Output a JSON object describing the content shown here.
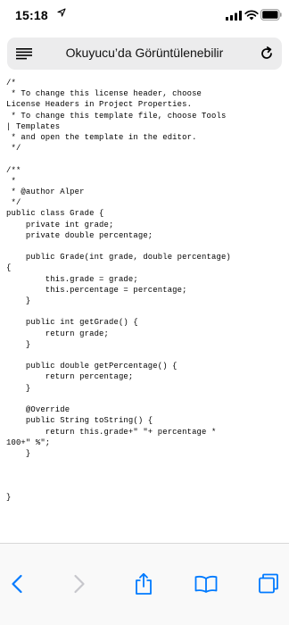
{
  "status_bar": {
    "time": "15:18"
  },
  "address_bar": {
    "url_text": "Okuyucu’da Görüntülenebilir"
  },
  "content": {
    "code_lines": [
      "/*",
      " * To change this license header, choose",
      "License Headers in Project Properties.",
      " * To change this template file, choose Tools",
      "| Templates",
      " * and open the template in the editor.",
      " */",
      "",
      "/**",
      " *",
      " * @author Alper",
      " */",
      "public class Grade {",
      "    private int grade;",
      "    private double percentage;",
      "",
      "    public Grade(int grade, double percentage)",
      "{",
      "        this.grade = grade;",
      "        this.percentage = percentage;",
      "    }",
      "",
      "    public int getGrade() {",
      "        return grade;",
      "    }",
      "",
      "    public double getPercentage() {",
      "        return percentage;",
      "    }",
      "",
      "    @Override",
      "    public String toString() {",
      "        return this.grade+\" \"+ percentage *",
      "100+\" %\";",
      "    }",
      "",
      "",
      "",
      "}"
    ]
  },
  "icons": {
    "status": [
      "location-arrow-icon",
      "cellular-signal-icon",
      "wifi-icon",
      "battery-icon"
    ],
    "address_bar": [
      "reader-view-icon",
      "reload-icon"
    ],
    "toolbar": [
      "back-icon",
      "forward-icon",
      "share-icon",
      "bookmarks-icon",
      "tabs-icon"
    ]
  },
  "colors": {
    "accent": "#007aff",
    "disabled": "#c7c7cc",
    "address_bar_bg": "#ececed",
    "toolbar_bg": "#f9f9f9"
  }
}
